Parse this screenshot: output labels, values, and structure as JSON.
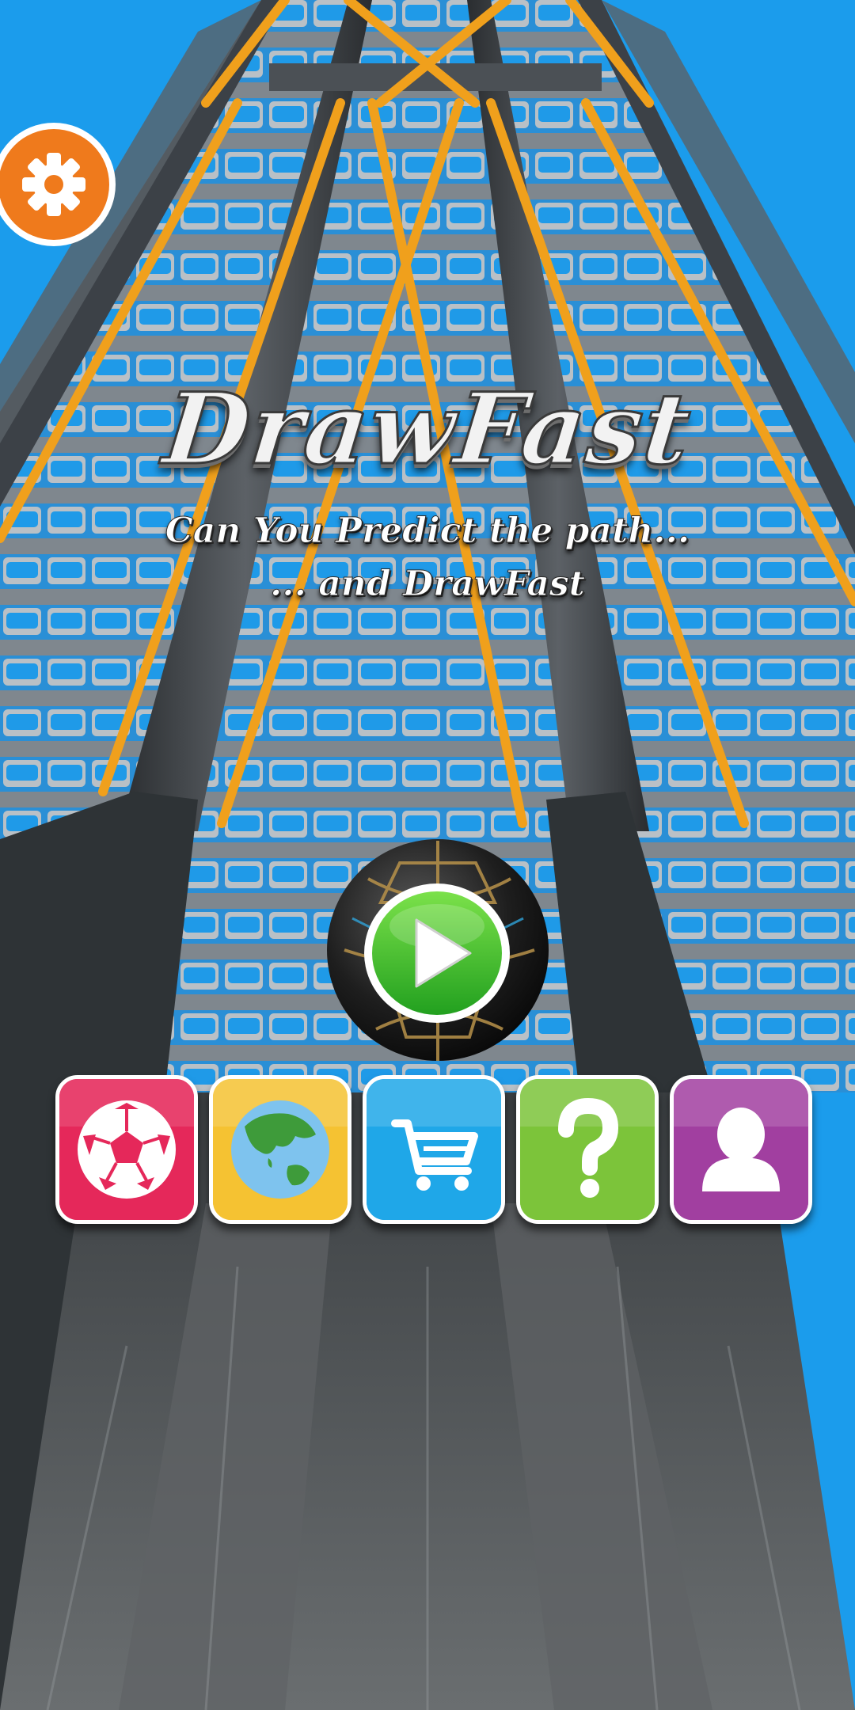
{
  "app": {
    "title": "DrawFast",
    "tagline_line1": "Can You Predict the path...",
    "tagline_line2": "... and DrawFast"
  },
  "buttons": {
    "settings": {
      "icon": "gear-icon",
      "color": "#f07a1e"
    },
    "play": {
      "icon": "play-icon",
      "color": "#3dbb2f"
    }
  },
  "menu": [
    {
      "id": "balls",
      "icon": "soccer-ball-icon",
      "color": "#e5285a"
    },
    {
      "id": "levels",
      "icon": "globe-icon",
      "color": "#f5c232"
    },
    {
      "id": "shop",
      "icon": "shopping-cart-icon",
      "color": "#1fa7e8"
    },
    {
      "id": "help",
      "icon": "question-mark-icon",
      "color": "#7cc43a"
    },
    {
      "id": "profile",
      "icon": "user-profile-icon",
      "color": "#a13fa0"
    }
  ]
}
